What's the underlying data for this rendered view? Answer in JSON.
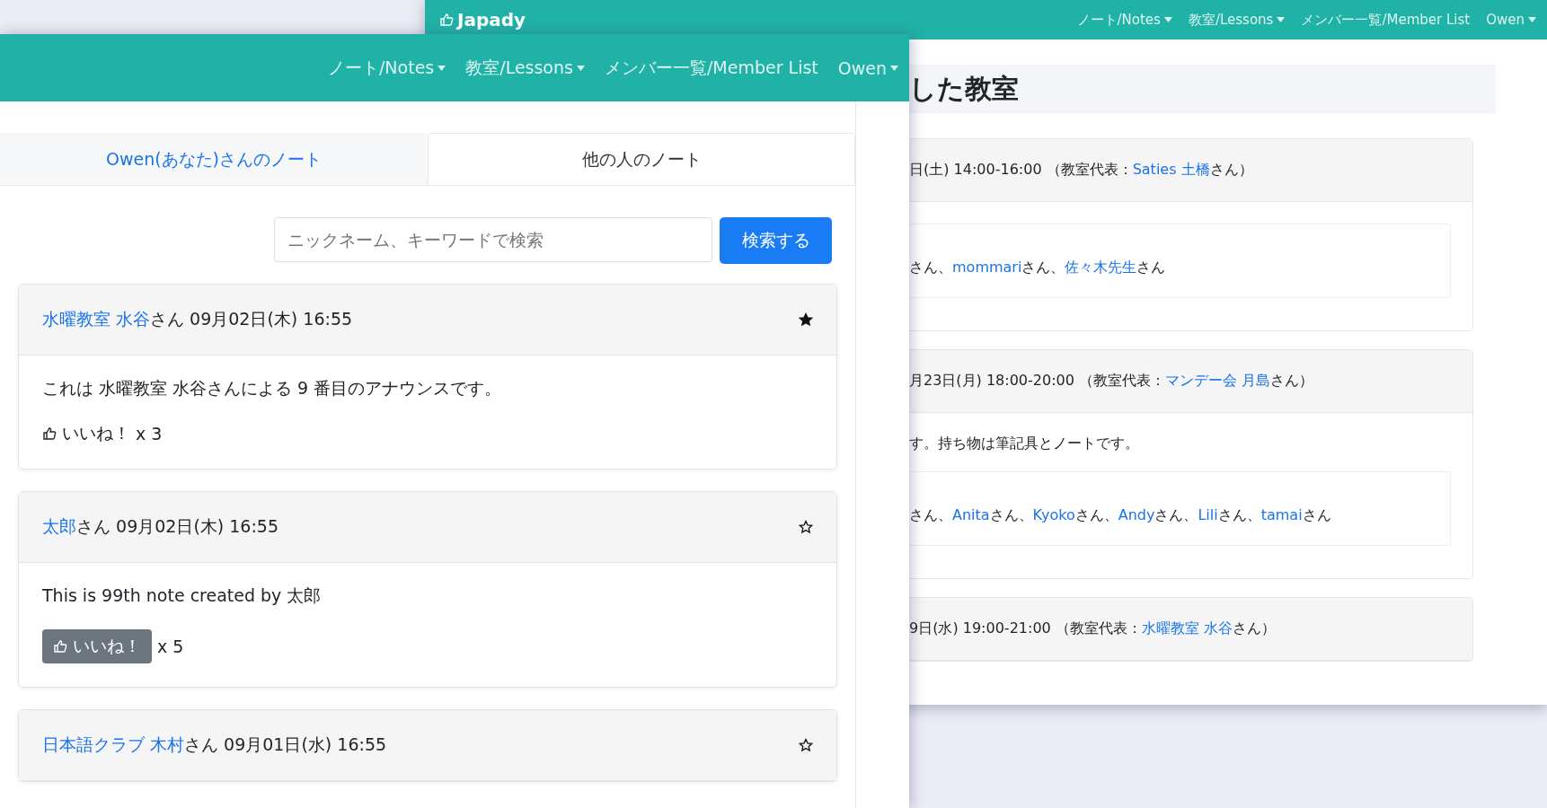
{
  "back_window": {
    "logo": "Japady",
    "nav": [
      {
        "label": "ノート/Notes",
        "dropdown": true
      },
      {
        "label": "教室/Lessons",
        "dropdown": true
      },
      {
        "label": "メンバー一覧/Member List",
        "dropdown": false
      },
      {
        "label": "Owen",
        "dropdown": true
      }
    ],
    "heading": "した教室",
    "lessons": [
      {
        "header": "日(土) 14:00-16:00 （教室代表：",
        "host": "Saties 土橋",
        "host_suffix": "さん）",
        "participants_lead": "さん、",
        "participants": [
          {
            "name": "mommari",
            "suffix": "さん、"
          },
          {
            "name": "佐々木先生",
            "suffix": "さん"
          }
        ]
      },
      {
        "header": "月23日(月) 18:00-20:00 （教室代表：",
        "host": "マンデー会 月島",
        "host_suffix": "さん）",
        "body": "す。持ち物は筆記具とノートです。",
        "participants_lead": "さん、",
        "participants": [
          {
            "name": "Anita",
            "suffix": "さん、"
          },
          {
            "name": "Kyoko",
            "suffix": "さん、"
          },
          {
            "name": "Andy",
            "suffix": "さん、"
          },
          {
            "name": "Lili",
            "suffix": "さん、"
          },
          {
            "name": "tamai",
            "suffix": "さん"
          }
        ]
      },
      {
        "header": "9日(水) 19:00-21:00 （教室代表：",
        "host": "水曜教室 水谷",
        "host_suffix": "さん）"
      }
    ]
  },
  "front_window": {
    "nav": [
      {
        "label": "ノート/Notes",
        "dropdown": true
      },
      {
        "label": "教室/Lessons",
        "dropdown": true
      },
      {
        "label": "メンバー一覧/Member List",
        "dropdown": false
      },
      {
        "label": "Owen",
        "dropdown": true
      }
    ],
    "tabs": [
      {
        "label": "Owen(あなた)さんのノート",
        "selected": false
      },
      {
        "label": "他の人のノート",
        "selected": true
      }
    ],
    "search": {
      "placeholder": "ニックネーム、キーワードで検索",
      "button": "検索する"
    },
    "notes": [
      {
        "author": "水曜教室 水谷",
        "author_suffix": "さん",
        "time": "09月02日(木) 16:55",
        "starred": true,
        "body": "これは 水曜教室 水谷さんによる 9 番目のアナウンスです。",
        "liked": false,
        "like_label": "いいね！",
        "count": "x 3"
      },
      {
        "author": "太郎",
        "author_suffix": "さん",
        "time": "09月02日(木) 16:55",
        "starred": false,
        "body": "This is 99th note created by 太郎",
        "liked": true,
        "like_label": "いいね！",
        "count": "x 5"
      },
      {
        "author": "日本語クラブ 木村",
        "author_suffix": "さん",
        "time": "09月01日(水) 16:55",
        "starred": false
      }
    ]
  }
}
